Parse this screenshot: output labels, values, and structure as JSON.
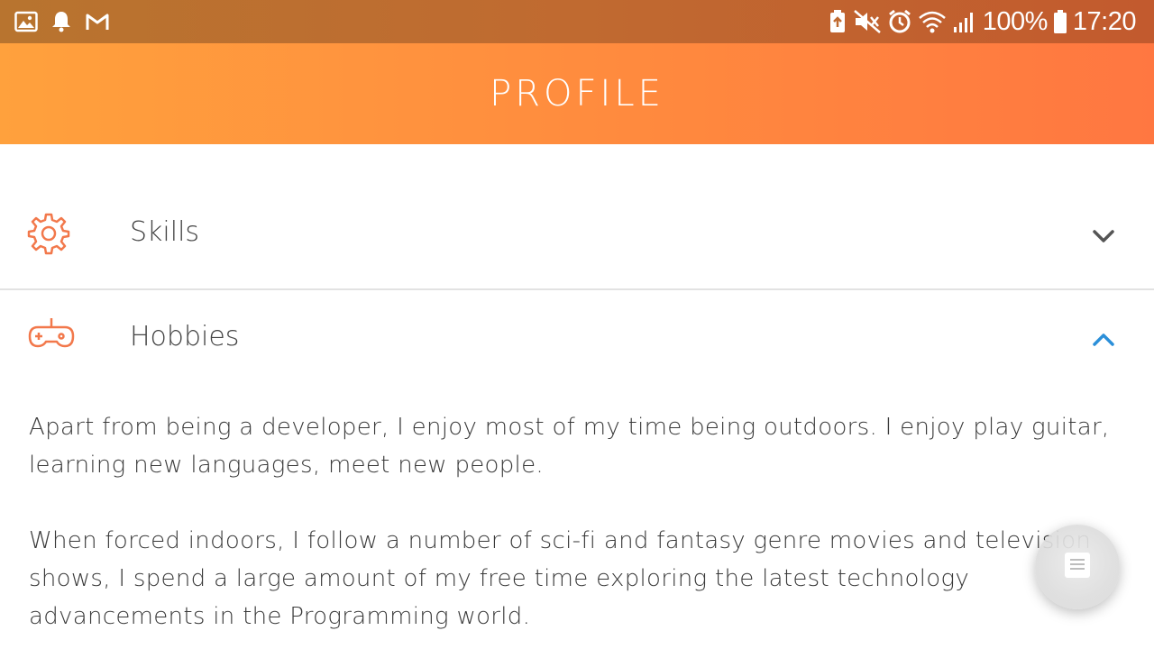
{
  "status_bar": {
    "battery_percent": "100%",
    "time": "17:20",
    "left_icons": [
      "gallery-icon",
      "bell-icon",
      "gmail-icon"
    ],
    "right_icons": [
      "battery-saver-icon",
      "mute-icon",
      "alarm-icon",
      "wifi-icon",
      "signal-icon",
      "battery-icon"
    ]
  },
  "app_bar": {
    "title": "PROFILE"
  },
  "sections": {
    "skills": {
      "label": "Skills",
      "icon": "gear-icon",
      "expanded": false
    },
    "hobbies": {
      "label": "Hobbies",
      "icon": "gamepad-icon",
      "expanded": true,
      "paragraphs": [
        "Apart from being a developer, I enjoy most of my time being outdoors. I enjoy play guitar, learning new languages, meet new people.",
        "When forced indoors, I follow a number of sci-fi and fantasy genre movies and television shows, I spend a large amount of my free time exploring the latest technology advancements in the Programming world."
      ]
    }
  },
  "fab": {
    "icon": "menu-list-icon"
  },
  "colors": {
    "accent": "#f2784b",
    "chevron_expanded": "#2b8fd9",
    "chevron_collapsed": "#555555",
    "appbar_start": "#ffa13d",
    "appbar_end": "#ff7741"
  }
}
